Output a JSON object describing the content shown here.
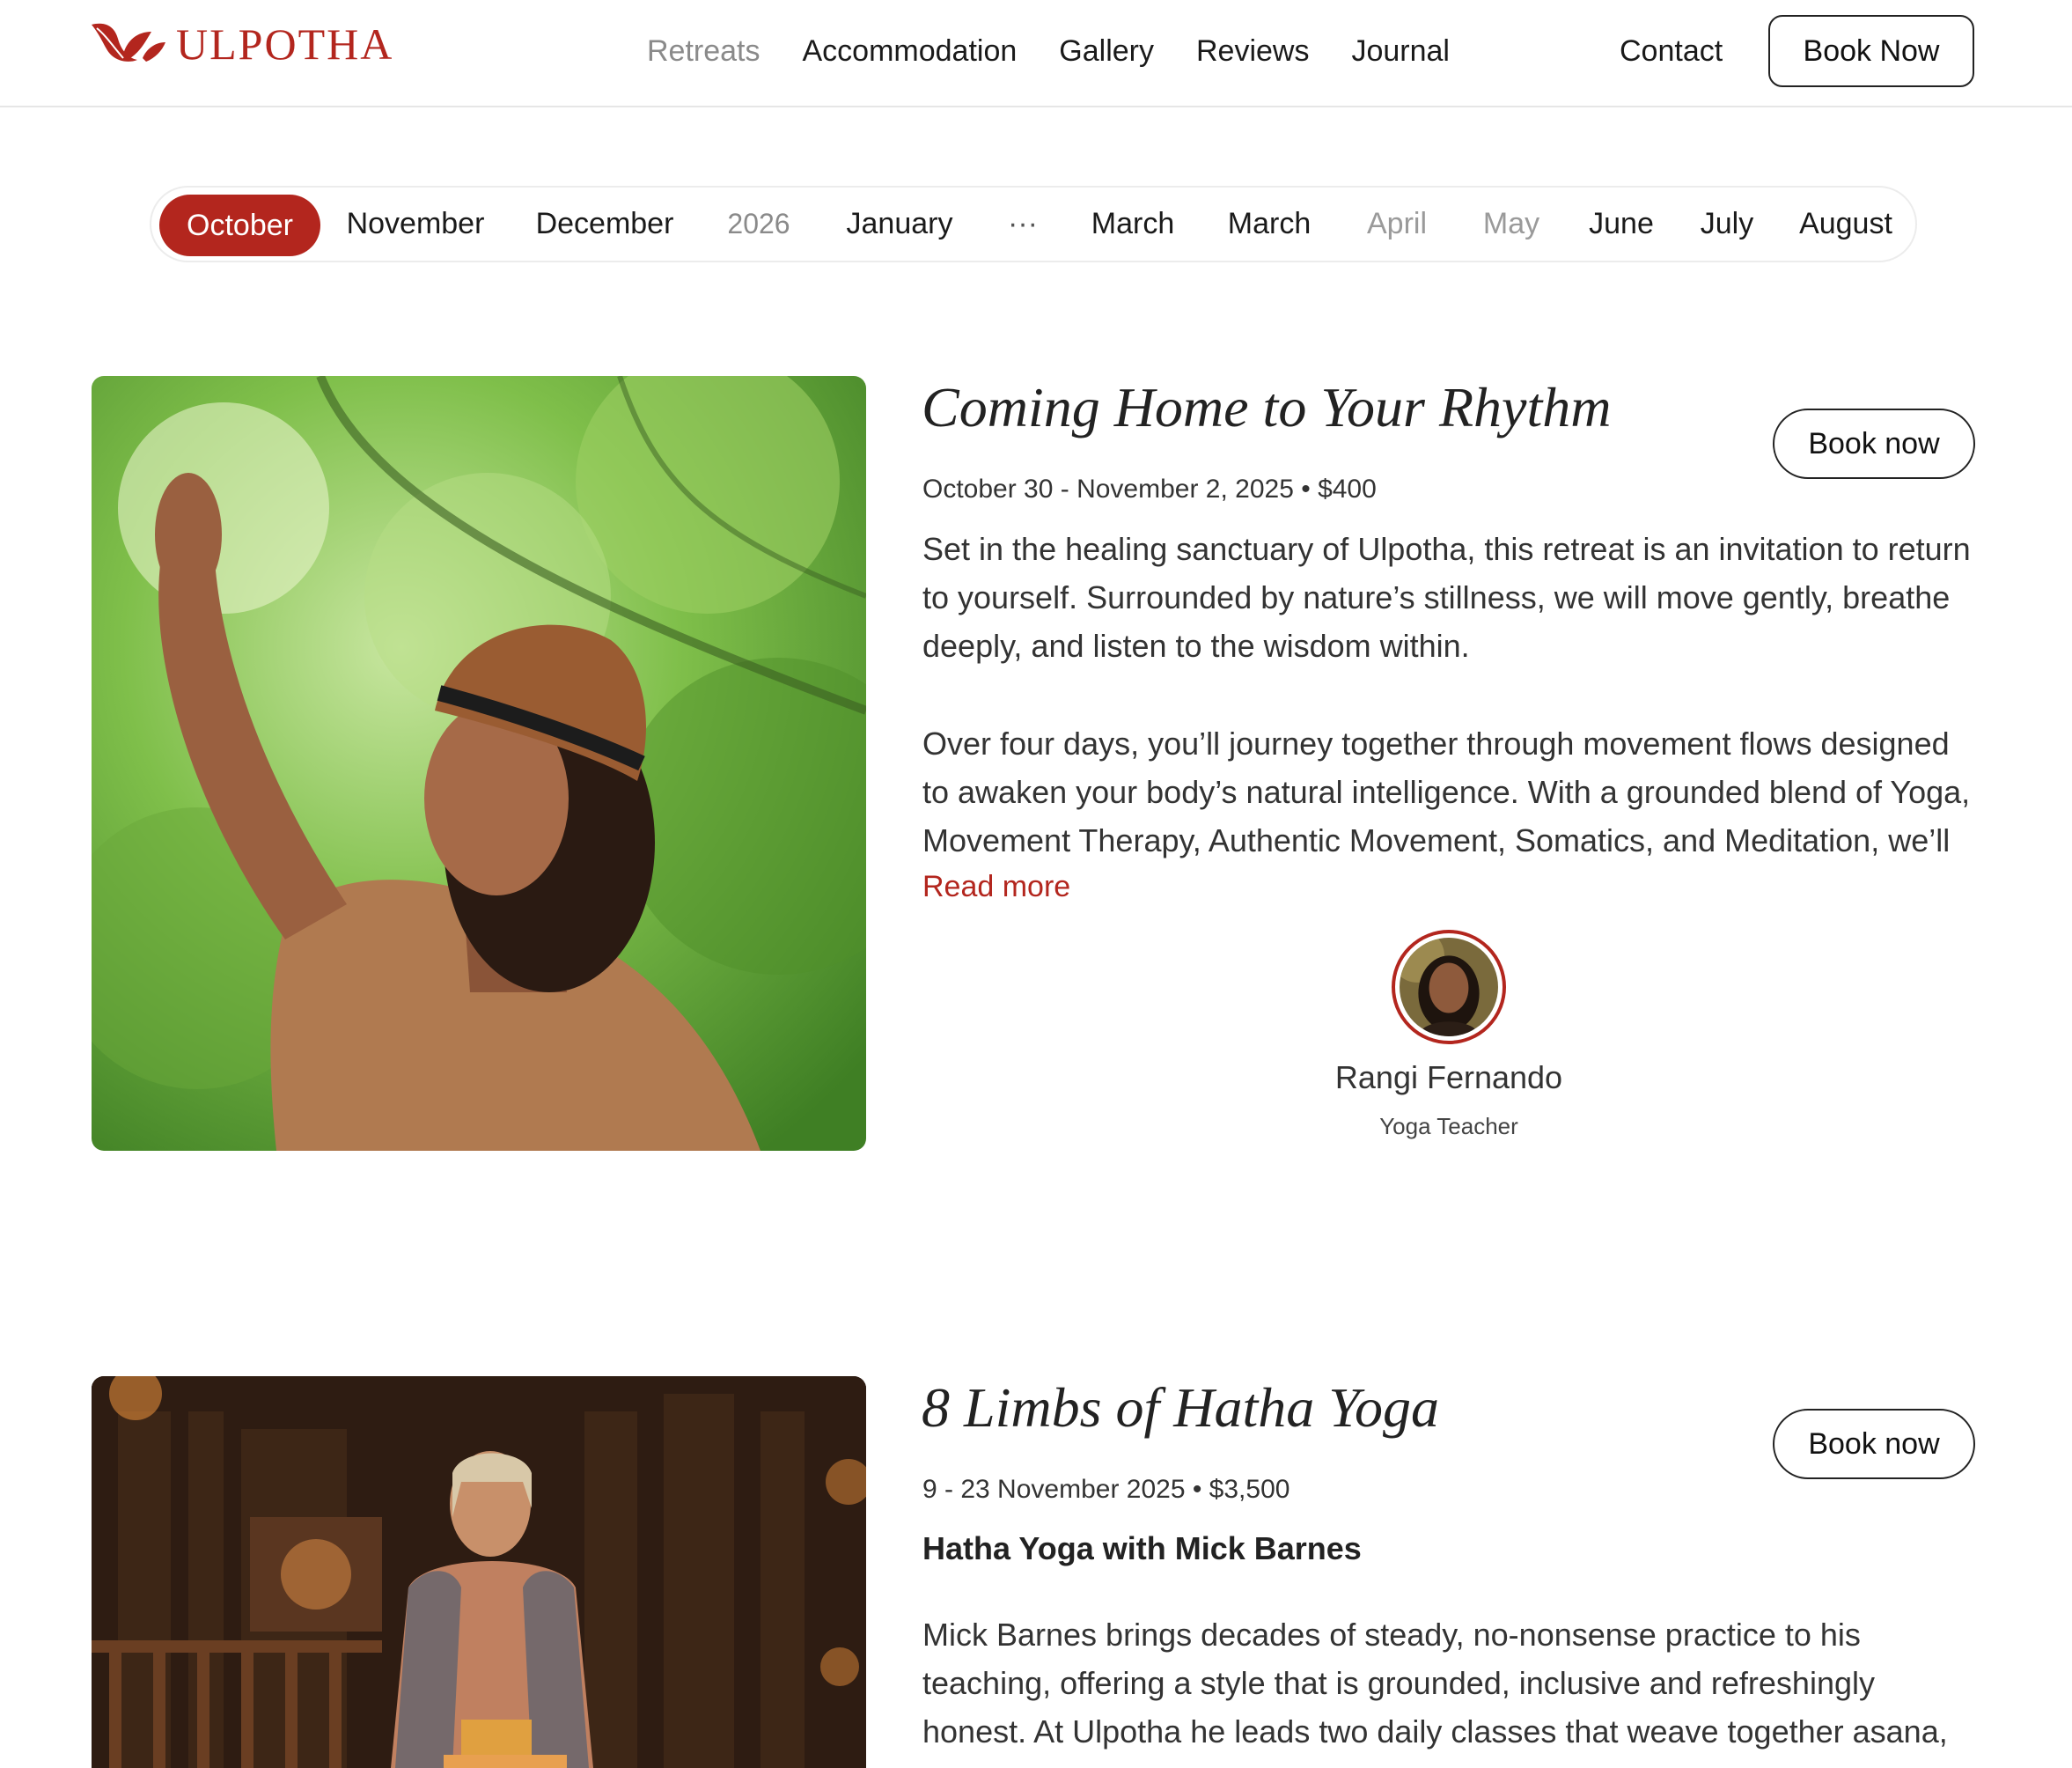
{
  "brand": {
    "name": "ULPOTHA",
    "accent": "#b3261e",
    "logo_icon": "leaf-bird-icon"
  },
  "nav": {
    "items": [
      {
        "label": "Retreats",
        "active": true
      },
      {
        "label": "Accommodation"
      },
      {
        "label": "Gallery"
      },
      {
        "label": "Reviews"
      },
      {
        "label": "Journal"
      }
    ],
    "contact": "Contact",
    "book_now": "Book Now"
  },
  "months": [
    {
      "label": "October",
      "state": "active"
    },
    {
      "label": "November"
    },
    {
      "label": "December"
    },
    {
      "label": "2026",
      "state": "year"
    },
    {
      "label": "January"
    },
    {
      "label": "···",
      "state": "ellipsis"
    },
    {
      "label": "March"
    },
    {
      "label": "March"
    },
    {
      "label": "April",
      "state": "muted"
    },
    {
      "label": "May",
      "state": "muted"
    },
    {
      "label": "June"
    },
    {
      "label": "July"
    },
    {
      "label": "August"
    }
  ],
  "retreats": [
    {
      "title": "Coming Home to Your Rhythm",
      "book_label": "Book now",
      "dates": "October 30 - November 2, 2025 • $400",
      "paragraph1": "Set in the healing sanctuary of Ulpotha, this retreat is an invitation to return to yourself. Surrounded by nature’s stillness, we will move gently, breathe deeply, and listen to the wisdom within.",
      "paragraph2": "Over four days, you’ll journey together through movement flows designed to awaken your body’s natural intelligence. With a grounded blend of Yoga, Movement Therapy, Authentic Movement, Somatics, and Meditation, we’ll",
      "read_more": "Read more",
      "teacher": {
        "name": "Rangi Fernando",
        "role": "Yoga Teacher"
      }
    },
    {
      "title": "8 Limbs of Hatha Yoga",
      "book_label": "Book now",
      "dates": "9 - 23 November 2025 • $3,500",
      "subtitle": "Hatha Yoga with Mick Barnes",
      "paragraph1": "Mick Barnes brings decades of steady, no-nonsense practice to his teaching, offering a style that is grounded, inclusive and refreshingly honest. At Ulpotha he leads two daily classes that weave together asana,"
    }
  ]
}
